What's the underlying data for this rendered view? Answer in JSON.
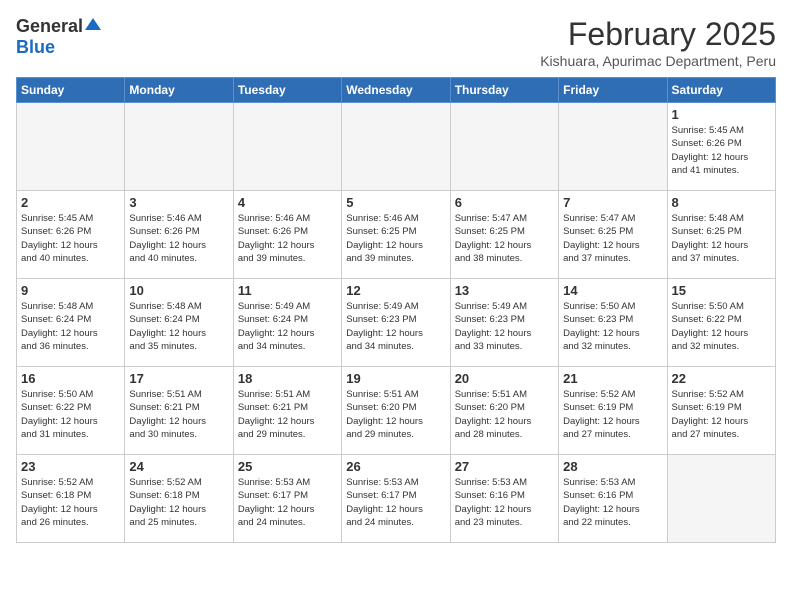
{
  "header": {
    "logo_general": "General",
    "logo_blue": "Blue",
    "month_title": "February 2025",
    "location": "Kishuara, Apurimac Department, Peru"
  },
  "days_of_week": [
    "Sunday",
    "Monday",
    "Tuesday",
    "Wednesday",
    "Thursday",
    "Friday",
    "Saturday"
  ],
  "weeks": [
    [
      {
        "day": "",
        "info": ""
      },
      {
        "day": "",
        "info": ""
      },
      {
        "day": "",
        "info": ""
      },
      {
        "day": "",
        "info": ""
      },
      {
        "day": "",
        "info": ""
      },
      {
        "day": "",
        "info": ""
      },
      {
        "day": "1",
        "info": "Sunrise: 5:45 AM\nSunset: 6:26 PM\nDaylight: 12 hours\nand 41 minutes."
      }
    ],
    [
      {
        "day": "2",
        "info": "Sunrise: 5:45 AM\nSunset: 6:26 PM\nDaylight: 12 hours\nand 40 minutes."
      },
      {
        "day": "3",
        "info": "Sunrise: 5:46 AM\nSunset: 6:26 PM\nDaylight: 12 hours\nand 40 minutes."
      },
      {
        "day": "4",
        "info": "Sunrise: 5:46 AM\nSunset: 6:26 PM\nDaylight: 12 hours\nand 39 minutes."
      },
      {
        "day": "5",
        "info": "Sunrise: 5:46 AM\nSunset: 6:25 PM\nDaylight: 12 hours\nand 39 minutes."
      },
      {
        "day": "6",
        "info": "Sunrise: 5:47 AM\nSunset: 6:25 PM\nDaylight: 12 hours\nand 38 minutes."
      },
      {
        "day": "7",
        "info": "Sunrise: 5:47 AM\nSunset: 6:25 PM\nDaylight: 12 hours\nand 37 minutes."
      },
      {
        "day": "8",
        "info": "Sunrise: 5:48 AM\nSunset: 6:25 PM\nDaylight: 12 hours\nand 37 minutes."
      }
    ],
    [
      {
        "day": "9",
        "info": "Sunrise: 5:48 AM\nSunset: 6:24 PM\nDaylight: 12 hours\nand 36 minutes."
      },
      {
        "day": "10",
        "info": "Sunrise: 5:48 AM\nSunset: 6:24 PM\nDaylight: 12 hours\nand 35 minutes."
      },
      {
        "day": "11",
        "info": "Sunrise: 5:49 AM\nSunset: 6:24 PM\nDaylight: 12 hours\nand 34 minutes."
      },
      {
        "day": "12",
        "info": "Sunrise: 5:49 AM\nSunset: 6:23 PM\nDaylight: 12 hours\nand 34 minutes."
      },
      {
        "day": "13",
        "info": "Sunrise: 5:49 AM\nSunset: 6:23 PM\nDaylight: 12 hours\nand 33 minutes."
      },
      {
        "day": "14",
        "info": "Sunrise: 5:50 AM\nSunset: 6:23 PM\nDaylight: 12 hours\nand 32 minutes."
      },
      {
        "day": "15",
        "info": "Sunrise: 5:50 AM\nSunset: 6:22 PM\nDaylight: 12 hours\nand 32 minutes."
      }
    ],
    [
      {
        "day": "16",
        "info": "Sunrise: 5:50 AM\nSunset: 6:22 PM\nDaylight: 12 hours\nand 31 minutes."
      },
      {
        "day": "17",
        "info": "Sunrise: 5:51 AM\nSunset: 6:21 PM\nDaylight: 12 hours\nand 30 minutes."
      },
      {
        "day": "18",
        "info": "Sunrise: 5:51 AM\nSunset: 6:21 PM\nDaylight: 12 hours\nand 29 minutes."
      },
      {
        "day": "19",
        "info": "Sunrise: 5:51 AM\nSunset: 6:20 PM\nDaylight: 12 hours\nand 29 minutes."
      },
      {
        "day": "20",
        "info": "Sunrise: 5:51 AM\nSunset: 6:20 PM\nDaylight: 12 hours\nand 28 minutes."
      },
      {
        "day": "21",
        "info": "Sunrise: 5:52 AM\nSunset: 6:19 PM\nDaylight: 12 hours\nand 27 minutes."
      },
      {
        "day": "22",
        "info": "Sunrise: 5:52 AM\nSunset: 6:19 PM\nDaylight: 12 hours\nand 27 minutes."
      }
    ],
    [
      {
        "day": "23",
        "info": "Sunrise: 5:52 AM\nSunset: 6:18 PM\nDaylight: 12 hours\nand 26 minutes."
      },
      {
        "day": "24",
        "info": "Sunrise: 5:52 AM\nSunset: 6:18 PM\nDaylight: 12 hours\nand 25 minutes."
      },
      {
        "day": "25",
        "info": "Sunrise: 5:53 AM\nSunset: 6:17 PM\nDaylight: 12 hours\nand 24 minutes."
      },
      {
        "day": "26",
        "info": "Sunrise: 5:53 AM\nSunset: 6:17 PM\nDaylight: 12 hours\nand 24 minutes."
      },
      {
        "day": "27",
        "info": "Sunrise: 5:53 AM\nSunset: 6:16 PM\nDaylight: 12 hours\nand 23 minutes."
      },
      {
        "day": "28",
        "info": "Sunrise: 5:53 AM\nSunset: 6:16 PM\nDaylight: 12 hours\nand 22 minutes."
      },
      {
        "day": "",
        "info": ""
      }
    ]
  ]
}
